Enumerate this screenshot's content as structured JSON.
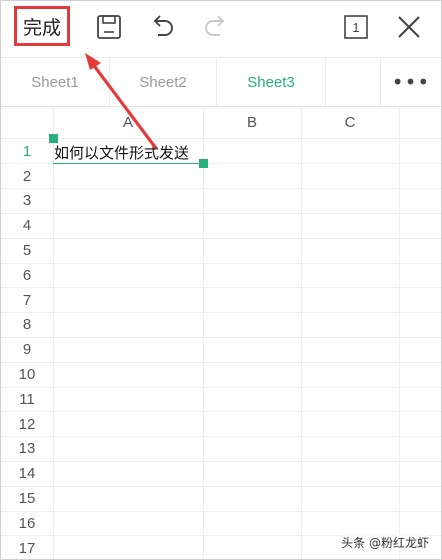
{
  "toolbar": {
    "done_label": "完成",
    "page_indicator": "1",
    "icons": [
      "save-icon",
      "undo-icon",
      "redo-icon",
      "page-icon",
      "close-icon"
    ]
  },
  "tabs": [
    {
      "label": "Sheet1",
      "active": false
    },
    {
      "label": "Sheet2",
      "active": false
    },
    {
      "label": "Sheet3",
      "active": true
    }
  ],
  "more_label": "•••",
  "columns": [
    "A",
    "B",
    "C"
  ],
  "rows": [
    "1",
    "2",
    "3",
    "4",
    "5",
    "6",
    "7",
    "8",
    "9",
    "10",
    "11",
    "12",
    "13",
    "14",
    "15",
    "16",
    "17"
  ],
  "cells": {
    "A1": "如何以文件形式发送"
  },
  "watermark": "头条 @粉红龙虾",
  "colors": {
    "accent": "#27b07e",
    "highlight": "#e33b3b"
  }
}
